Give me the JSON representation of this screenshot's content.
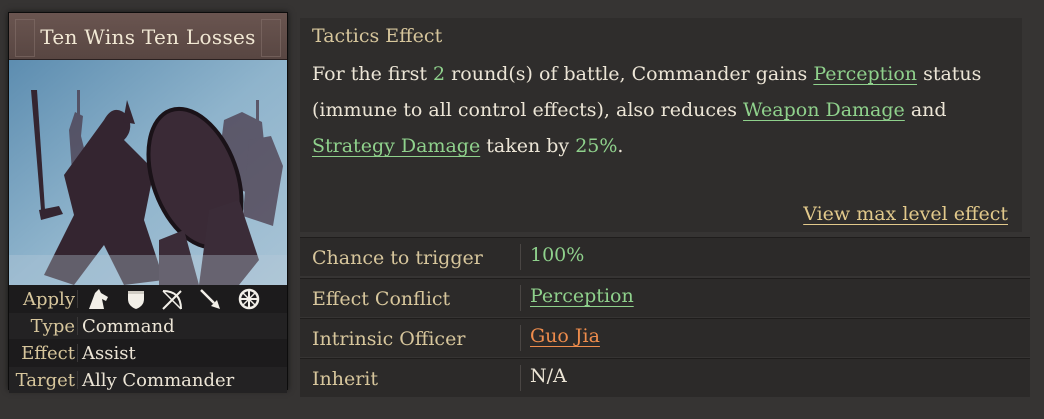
{
  "card": {
    "title": "Ten Wins Ten Losses",
    "apply_label": "Apply",
    "apply_icons": [
      "cavalry-icon",
      "shield-icon",
      "archer-icon",
      "spear-icon",
      "siege-icon"
    ],
    "rows": [
      {
        "label": "Type",
        "value": "Command"
      },
      {
        "label": "Effect",
        "value": "Assist"
      },
      {
        "label": "Target",
        "value": "Ally Commander"
      }
    ]
  },
  "effect": {
    "heading": "Tactics Effect",
    "t1": "For the first ",
    "rounds": "2",
    "t2": " round(s) of battle, Commander gains ",
    "kw1": "Perception",
    "t3": " status (immune to all control effects), also reduces ",
    "kw2": "Weapon Damage",
    "t4": " and ",
    "kw3": "Strategy Damage",
    "t5": " taken by ",
    "pct": "25%",
    "t6": ".",
    "view_max": "View max level effect"
  },
  "stats": [
    {
      "label": "Chance to trigger",
      "value": "100%",
      "style": "green"
    },
    {
      "label": "Effect Conflict",
      "value": "Perception",
      "style": "link-green"
    },
    {
      "label": "Intrinsic Officer",
      "value": "Guo Jia",
      "style": "link-orange"
    },
    {
      "label": "Inherit",
      "value": "N/A",
      "style": "plain"
    }
  ],
  "colors": {
    "background": "#363433",
    "label_gold": "#d7c69c",
    "keyword_green": "#8fd18c",
    "officer_orange": "#ee8c4c",
    "link_gold": "#e2c98b"
  }
}
